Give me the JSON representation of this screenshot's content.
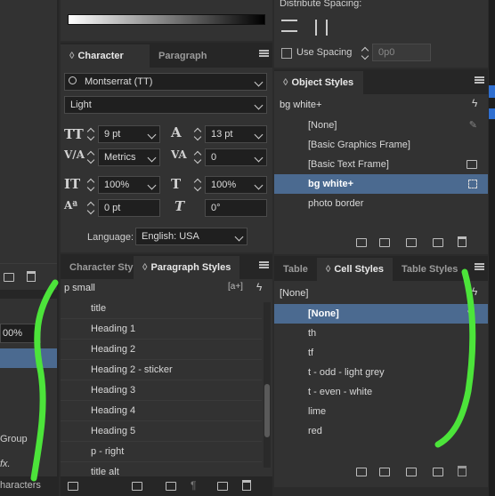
{
  "left_partial": {
    "zoom_value": "00%",
    "group_label": "Group",
    "characters_label": "haracters",
    "fx_label": "fx."
  },
  "top_middle": {
    "distribute_label": "Distribute Spacing:",
    "use_spacing_label": "Use Spacing",
    "spacing_value": "0p0"
  },
  "character_panel": {
    "tabs": [
      "Character",
      "Paragraph"
    ],
    "font_family": "Montserrat (TT)",
    "font_style": "Light",
    "size": "9 pt",
    "leading": "13 pt",
    "kerning": "Metrics",
    "tracking": "0",
    "vertical_scale": "100%",
    "horizontal_scale": "100%",
    "baseline_shift": "0 pt",
    "skew": "0°",
    "language_label": "Language:",
    "language_value": "English: USA"
  },
  "object_styles": {
    "title": "Object Styles",
    "current": "bg white+",
    "items": [
      "[None]",
      "[Basic Graphics Frame]",
      "[Basic Text Frame]",
      "bg white+",
      "photo border"
    ],
    "selected_index": 3
  },
  "paragraph_styles": {
    "tabs": [
      "Character Styles",
      "Paragraph Styles"
    ],
    "current": "p small",
    "items": [
      "title",
      "Heading 1",
      "Heading 2",
      "Heading 2 - sticker",
      "Heading 3",
      "Heading 4",
      "Heading 5",
      "p - right",
      "title alt"
    ]
  },
  "cell_styles": {
    "tabs": [
      "Table",
      "Cell Styles",
      "Table Styles"
    ],
    "current": "[None]",
    "items": [
      "[None]",
      "th",
      "tf",
      "t - odd - light grey",
      "t - even - white",
      "lime",
      "red"
    ],
    "selected_index": 0
  },
  "colors": {
    "panel": "#323232",
    "selection": "#4b6a90",
    "annotation": "#4ce43a"
  }
}
